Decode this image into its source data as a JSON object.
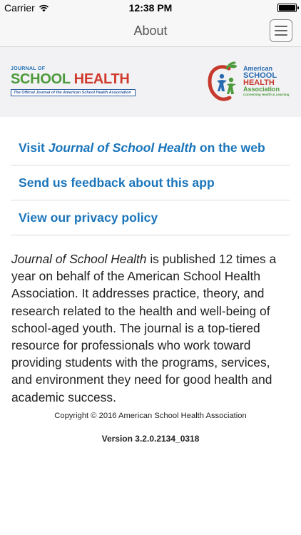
{
  "status_bar": {
    "carrier": "Carrier",
    "time": "12:38 PM",
    "battery_level": 1.0
  },
  "nav": {
    "title": "About",
    "menu_icon": "hamburger-menu-icon"
  },
  "logos": {
    "journal": {
      "top_line": "JOURNAL OF",
      "word_school": "SCHOOL",
      "word_health": "HEALTH",
      "tagline": "The Official Journal of the American School Health Association"
    },
    "association": {
      "line1": "American",
      "line2": "SCHOOL",
      "line3": "HEALTH",
      "line4": "Association",
      "slogan": "Connecting Health & Learning"
    }
  },
  "links": [
    {
      "prefix": "Visit ",
      "emphasis": "Journal of School Health",
      "suffix": " on the web"
    },
    {
      "prefix": "Send us feedback about this app",
      "emphasis": "",
      "suffix": ""
    },
    {
      "prefix": "View our privacy policy",
      "emphasis": "",
      "suffix": ""
    }
  ],
  "description": {
    "emphasis": "Journal of School Health",
    "body": " is published 12 times a year on behalf of the American School Health Association. It addresses practice, theory, and research related to the health and well-being of school-aged youth. The journal is a top-tiered resource for professionals who work toward providing students with the programs, services, and environment they need for good health and academic success."
  },
  "footer": {
    "copyright": "Copyright © 2016 American School Health Association",
    "version": "Version 3.2.0.2134_0318"
  },
  "colors": {
    "link_blue": "#1a75bb",
    "logo_green": "#4d9a3c",
    "logo_red": "#d03b2e"
  }
}
